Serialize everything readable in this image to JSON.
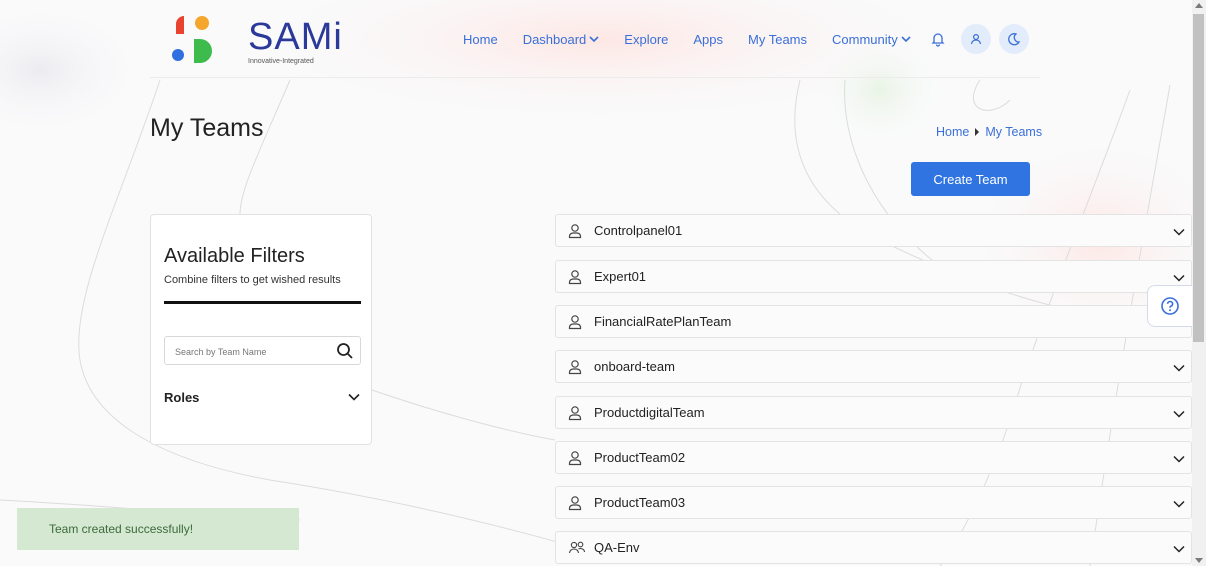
{
  "brand": {
    "name": "SAMi",
    "tagline": "Innovative-Integrated",
    "colors": {
      "red": "#e8432f",
      "orange": "#f4a72c",
      "blue": "#2f6fe0",
      "green": "#3dbb4d",
      "title": "#2b3a9a"
    }
  },
  "nav": {
    "items": [
      {
        "label": "Home"
      },
      {
        "label": "Dashboard",
        "dropdown": true
      },
      {
        "label": "Explore"
      },
      {
        "label": "Apps"
      },
      {
        "label": "My Teams"
      },
      {
        "label": "Community",
        "dropdown": true
      }
    ],
    "icons": [
      "bell-icon",
      "user-icon",
      "moon-icon"
    ]
  },
  "page": {
    "title": "My Teams"
  },
  "breadcrumb": {
    "home": "Home",
    "current": "My Teams"
  },
  "actions": {
    "create_team": "Create Team"
  },
  "filters": {
    "title": "Available Filters",
    "subtitle": "Combine filters to get wished results",
    "search_placeholder": "Search by Team Name",
    "roles_label": "Roles"
  },
  "teams": [
    {
      "name": "Controlpanel01",
      "icon": "user-icon"
    },
    {
      "name": "Expert01",
      "icon": "user-icon"
    },
    {
      "name": "FinancialRatePlanTeam",
      "icon": "user-icon"
    },
    {
      "name": "onboard-team",
      "icon": "user-icon"
    },
    {
      "name": "ProductdigitalTeam",
      "icon": "user-icon"
    },
    {
      "name": "ProductTeam02",
      "icon": "user-icon"
    },
    {
      "name": "ProductTeam03",
      "icon": "user-icon"
    },
    {
      "name": "QA-Env",
      "icon": "users-icon"
    }
  ],
  "toast": {
    "message": "Team created successfully!",
    "color": "#d4e8d2"
  },
  "accent": "#2f74e0"
}
